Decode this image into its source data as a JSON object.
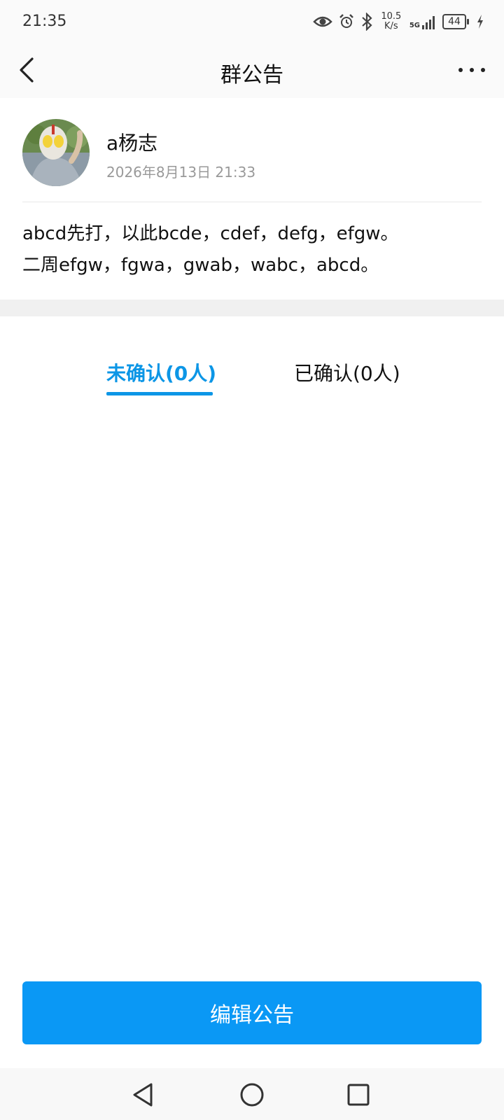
{
  "status_bar": {
    "time": "21:35",
    "speed_value": "10.5",
    "speed_unit": "K/s",
    "network": "5G",
    "battery": "44"
  },
  "header": {
    "title": "群公告",
    "back_icon": "chevron-left-icon",
    "more_icon": "ellipsis-icon"
  },
  "post": {
    "author": "a杨志",
    "timestamp": "2026年8月13日 21:33",
    "content_line1": "abcd先打，以此bcde，cdef，defg，efgw。",
    "content_line2": "二周efgw，fgwa，gwab，wabc，abcd。"
  },
  "tabs": [
    {
      "label": "未确认(0人)",
      "active": true
    },
    {
      "label": "已确认(0人)",
      "active": false
    }
  ],
  "actions": {
    "edit_label": "编辑公告"
  },
  "colors": {
    "accent": "#0c96e6",
    "button": "#0a98f5"
  }
}
